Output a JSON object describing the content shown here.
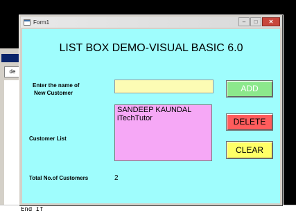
{
  "background": {
    "ide_box_label": "de",
    "code_line": "End If"
  },
  "window": {
    "title": "Form1",
    "minimize_symbol": "–",
    "maximize_symbol": "□",
    "close_symbol": "✕"
  },
  "form": {
    "heading": "LIST BOX DEMO-VISUAL BASIC 6.0",
    "name_label_line1": "Enter the name of",
    "name_label_line2": "New Customer",
    "name_input_value": "",
    "customer_list_label": "Customer List",
    "customers": [
      "SANDEEP KAUNDAL",
      "iTechTutor"
    ],
    "total_label": "Total No.of Customers",
    "total_value": "2",
    "add_label": "ADD",
    "delete_label": "DELETE",
    "clear_label": "CLEAR"
  },
  "colors": {
    "form_background": "#9ffdfd",
    "textbox": "#fcfcb4",
    "listbox": "#f6a8f6",
    "add_button": "#8ce88c",
    "delete_button": "#ff5c5c",
    "clear_button": "#ffff66"
  }
}
